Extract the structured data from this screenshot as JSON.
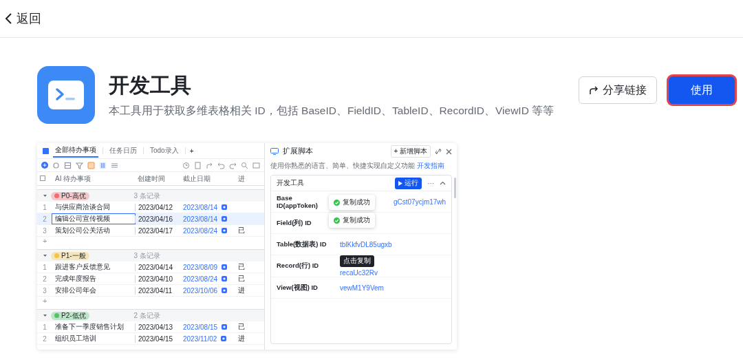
{
  "top_bar": {
    "back": "返回"
  },
  "tool": {
    "title": "开发工具",
    "description": "本工具用于获取多维表格相关 ID，包括 BaseID、FieldID、TableID、RecordID、ViewID 等等",
    "share_button": "分享链接",
    "use_button": "使用",
    "use_button_highlighted": true
  },
  "preview": {
    "tabs": [
      {
        "label": "全部待办事项",
        "selected": true
      },
      {
        "label": "任务日历",
        "selected": false
      },
      {
        "label": "Todo录入",
        "selected": false
      }
    ],
    "add_tab": "+",
    "select_all_checked": false,
    "columns": [
      "AI 待办事项",
      "创建时间",
      "截止日期",
      "进"
    ],
    "groups": [
      {
        "name": "P0-高优",
        "color": "#f26d6d",
        "count": "3 条记录",
        "add_row": "+",
        "rows": [
          {
            "index": "1",
            "title": "与供应商洽谈合同",
            "created": "2023/04/12",
            "due": "2023/08/14",
            "selected": false
          },
          {
            "index": "2",
            "title": "编辑公司宣传视频",
            "created": "2023/04/16",
            "due": "2023/08/14",
            "selected": true
          },
          {
            "index": "3",
            "title": "策划公司公关活动",
            "created": "2023/04/17",
            "due": "2023/08/24",
            "status": "已",
            "selected": false
          }
        ]
      },
      {
        "name": "P1-一般",
        "color": "#f5c242",
        "count": "3 条记录",
        "add_row": "+",
        "rows": [
          {
            "index": "1",
            "title": "跟进客户反馈意见",
            "created": "2023/04/14",
            "due": "2023/08/09",
            "status": "已",
            "selected": false
          },
          {
            "index": "2",
            "title": "完成年度报告",
            "created": "2023/04/10",
            "due": "2023/08/24",
            "status": "已",
            "selected": false
          },
          {
            "index": "3",
            "title": "安排公司年会",
            "created": "2023/04/11",
            "due": "2023/10/06",
            "status": "进",
            "selected": false
          }
        ]
      },
      {
        "name": "P2-低优",
        "color": "#52c46a",
        "count": "2 条记录",
        "rows": [
          {
            "index": "1",
            "title": "准备下一季度销售计划",
            "created": "2023/04/13",
            "due": "2023/08/15",
            "status": "已",
            "selected": false
          },
          {
            "index": "2",
            "title": "组织员工培训",
            "created": "2023/04/15",
            "due": "2023/11/02",
            "status": "进",
            "selected": false
          }
        ]
      }
    ],
    "panel": {
      "title": "扩展脚本",
      "new_button": "+ 新增脚本",
      "description": "使用你熟悉的语言、简单、快捷实现自定义功能",
      "guide_link": "开发指南",
      "card": {
        "title": "开发工具",
        "run_button": "运行",
        "more": "···",
        "fields": [
          {
            "label": "Base ID(appToken)",
            "value": "gCst07ycjm17wh"
          },
          {
            "label": "Field(列) ID"
          },
          {
            "label": "Table(数据表) ID",
            "value": "tblKkfvDL85ugxb"
          },
          {
            "label": "Record(行) ID",
            "value": "recaUc32Rv",
            "tooltip": "点击复制"
          },
          {
            "label": "View(视图) ID",
            "value": "vewM1Y9Vem"
          }
        ],
        "toasts": [
          "复制成功",
          "复制成功"
        ]
      }
    }
  }
}
